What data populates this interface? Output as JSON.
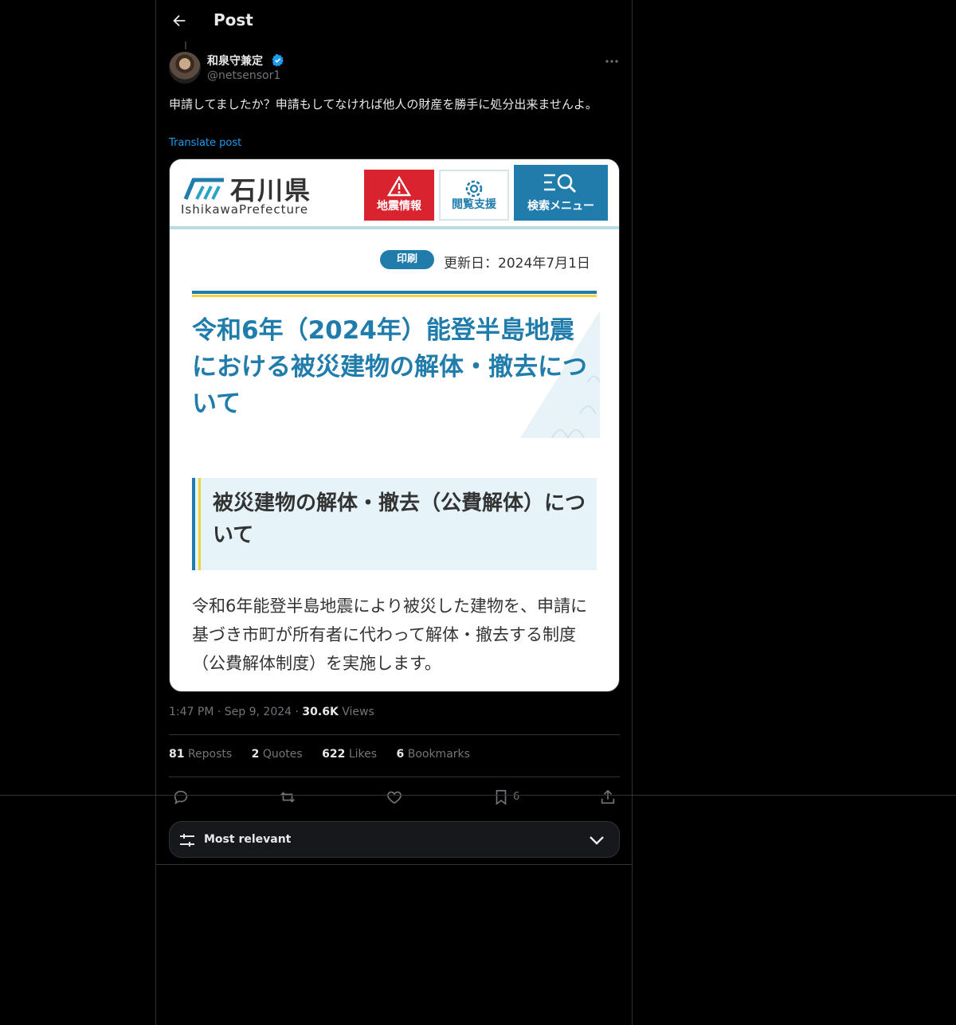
{
  "header": {
    "title": "Post"
  },
  "author": {
    "name": "和泉守兼定",
    "handle": "@netsensor1"
  },
  "post": {
    "text": "申請してましたか？申請もしてなければ他人の財産を勝手に処分出来ませんよ。",
    "translate_label": "Translate post"
  },
  "image_card": {
    "logo_jp": "石川県",
    "logo_en": "IshikawaPrefecture",
    "nav": {
      "quake": "地震情報",
      "access": "閲覧支援",
      "search": "検索メニュー"
    },
    "print_label": "印刷",
    "updated": "更新日：2024年7月1日",
    "title": "令和6年（2024年）能登半島地震における被災建物の解体・撤去について",
    "subtitle": "被災建物の解体・撤去（公費解体）について",
    "body": "令和6年能登半島地震により被災した建物を、申請に基づき市町が所有者に代わって解体・撤去する制度（公費解体制度）を実施します。"
  },
  "meta": {
    "time": "1:47 PM",
    "dot": "·",
    "date": "Sep 9, 2024",
    "views_count": "30.6K",
    "views_label": "Views"
  },
  "stats": {
    "reposts": {
      "count": "81",
      "label": "Reposts"
    },
    "quotes": {
      "count": "2",
      "label": "Quotes"
    },
    "likes": {
      "count": "622",
      "label": "Likes"
    },
    "bookmarks": {
      "count": "6",
      "label": "Bookmarks"
    }
  },
  "actions": {
    "bookmark_count": "6"
  },
  "sort": {
    "label": "Most relevant"
  },
  "colors": {
    "accent": "#1d9bf0",
    "background": "#000000",
    "muted": "#71767b",
    "ishikawa_blue": "#1f7cab",
    "quake_red": "#d9232e"
  }
}
